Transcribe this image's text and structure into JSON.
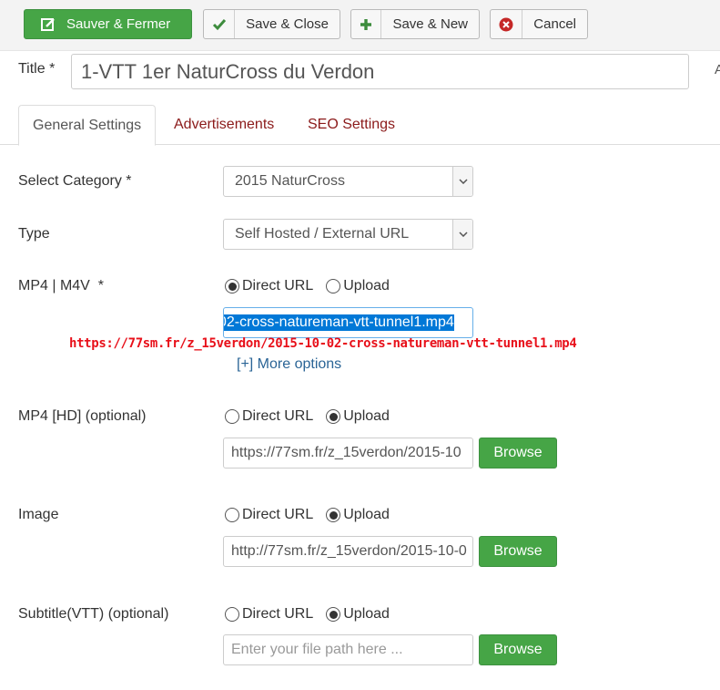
{
  "toolbar": {
    "save_close_fr": "Sauver & Fermer",
    "save_close": "Save & Close",
    "save_new": "Save & New",
    "cancel": "Cancel",
    "colors": {
      "green": "#46a546",
      "cancel_icon": "#c52827",
      "check": "#3d8c3d"
    }
  },
  "title": {
    "label": "Title *",
    "value": "1-VTT 1er NaturCross du Verdon",
    "edge_char": "A"
  },
  "tabs": [
    {
      "label": "General Settings",
      "active": true
    },
    {
      "label": "Advertisements",
      "active": false
    },
    {
      "label": "SEO Settings",
      "active": false
    }
  ],
  "fields": {
    "category": {
      "label": "Select Category *",
      "value": "2015 NaturCross"
    },
    "type": {
      "label": "Type",
      "value": "Self Hosted / External URL"
    },
    "mp4": {
      "label": "MP4 | M4V  *",
      "radio_direct": "Direct URL",
      "radio_upload": "Upload",
      "selected": "direct",
      "input_value": "02-cross-natureman-vtt-tunnel1.mp4",
      "more_options": "[+] More options"
    },
    "mp4_hd": {
      "label": "MP4 [HD] (optional)",
      "radio_direct": "Direct URL",
      "radio_upload": "Upload",
      "selected": "upload",
      "input_value": "https://77sm.fr/z_15verdon/2015-10",
      "browse": "Browse"
    },
    "image": {
      "label": "Image",
      "radio_direct": "Direct URL",
      "radio_upload": "Upload",
      "selected": "upload",
      "input_value": "http://77sm.fr/z_15verdon/2015-10-0",
      "browse": "Browse"
    },
    "subtitle": {
      "label": "Subtitle(VTT) (optional)",
      "radio_direct": "Direct URL",
      "radio_upload": "Upload",
      "selected": "upload",
      "placeholder": "Enter your file path here ...",
      "browse": "Browse"
    }
  },
  "annotation": {
    "text": "https://77sm.fr/z_15verdon/2015-10-02-cross-natureman-vtt-tunnel1.mp4",
    "color": "#e8101a"
  }
}
